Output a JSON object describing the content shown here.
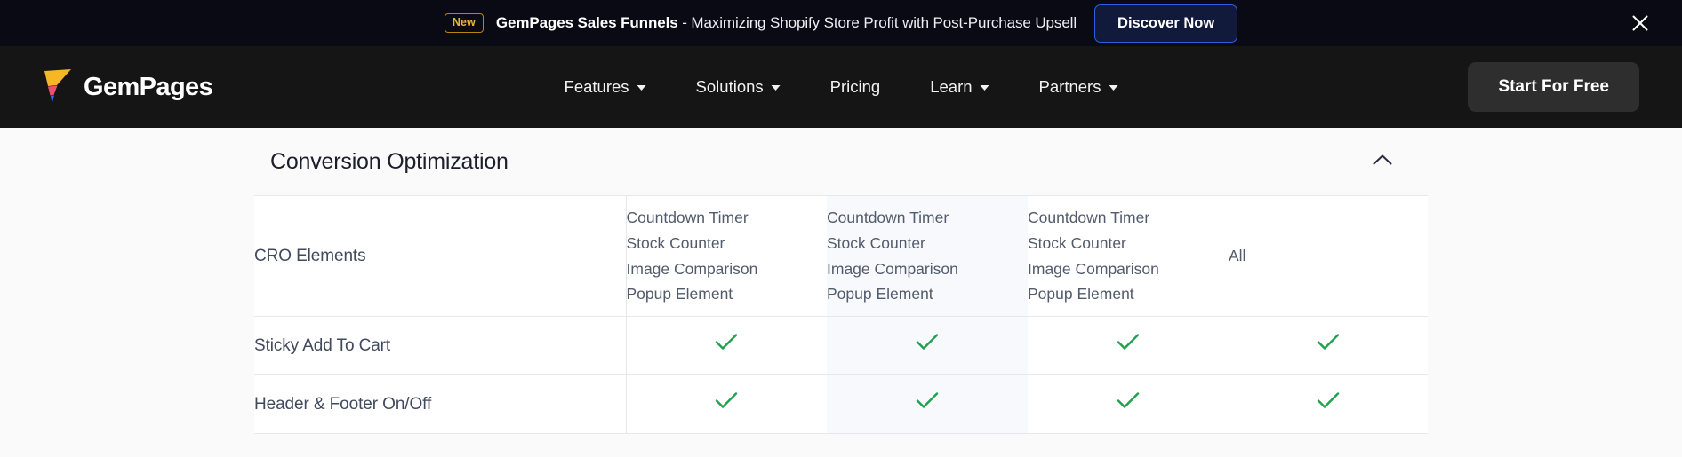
{
  "promo_banner": {
    "badge": "New",
    "headline": "GemPages Sales Funnels",
    "tail": " - Maximizing Shopify Store Profit with Post-Purchase Upsell",
    "cta_label": "Discover Now",
    "close_icon": "close-icon",
    "background": "#0a0a14",
    "badge_color": "#e8b33c",
    "cta_border": "#2b5fe3"
  },
  "nav": {
    "brand": "GemPages",
    "items": [
      {
        "label": "Features",
        "has_dropdown": true
      },
      {
        "label": "Solutions",
        "has_dropdown": true
      },
      {
        "label": "Pricing",
        "has_dropdown": false
      },
      {
        "label": "Learn",
        "has_dropdown": true
      },
      {
        "label": "Partners",
        "has_dropdown": true
      }
    ],
    "cta_label": "Start For Free",
    "background": "#151515"
  },
  "section": {
    "title": "Conversion Optimization",
    "toggle_icon": "chevron-up-icon",
    "expanded": true
  },
  "table": {
    "rows": [
      {
        "feature": "CRO Elements",
        "cells": [
          "Countdown Timer\nStock Counter\nImage Comparison\nPopup Element",
          "Countdown Timer\nStock Counter\nImage Comparison\nPopup Element",
          "Countdown Timer\nStock Counter\nImage Comparison\nPopup Element",
          "All"
        ],
        "type": "text"
      },
      {
        "feature": "Sticky Add To Cart",
        "cells": [
          "check",
          "check",
          "check",
          "check"
        ],
        "type": "check"
      },
      {
        "feature": "Header & Footer On/Off",
        "cells": [
          "check",
          "check",
          "check",
          "check"
        ],
        "type": "check"
      }
    ],
    "check_color": "#1fa24e",
    "highlight_column_index": 1,
    "highlight_color": "#f7f9fd"
  }
}
